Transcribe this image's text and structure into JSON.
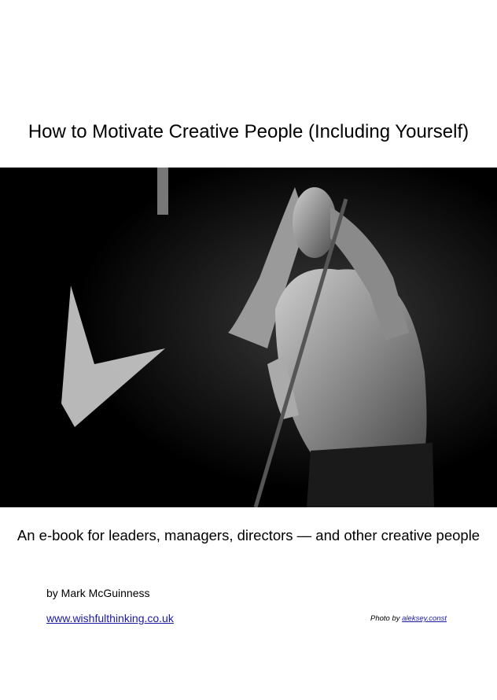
{
  "title": "How to Motivate Creative People (Including Yourself)",
  "subtitle": "An e-book for leaders, managers, directors — and other creative people",
  "author": "by Mark McGuinness",
  "website": "www.wishfulthinking.co.uk",
  "photo_credit": {
    "prefix": "Photo by",
    "name": "aleksey.const"
  }
}
